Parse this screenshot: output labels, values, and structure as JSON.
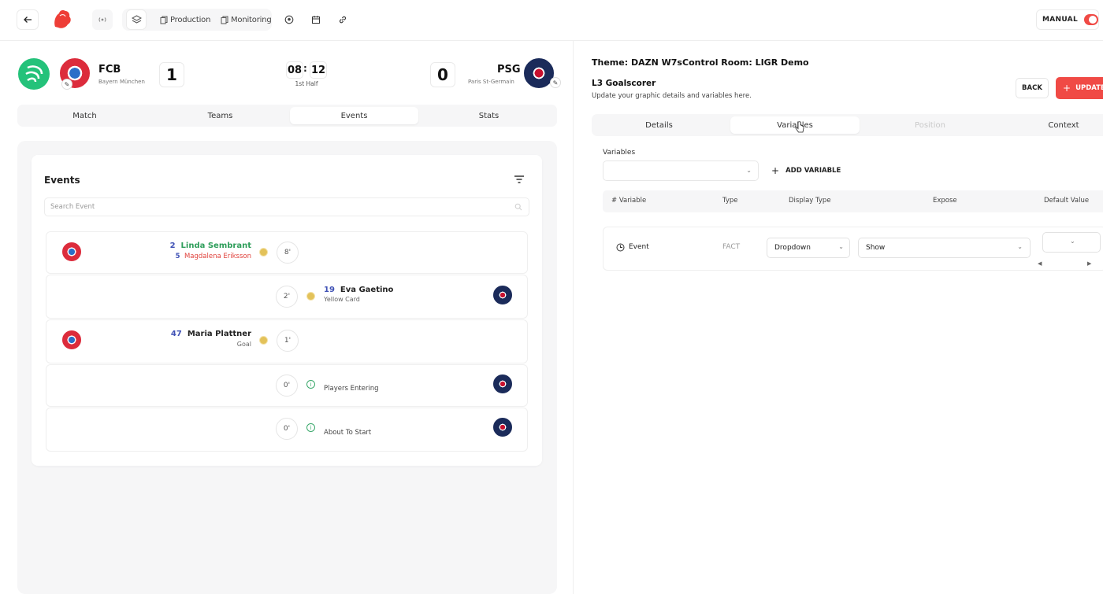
{
  "topbar": {
    "production_label": "Production",
    "monitoring_label": "Monitoring",
    "manual_label": "MANUAL",
    "manual_on": true
  },
  "match": {
    "home": {
      "code": "FCB",
      "name": "Bayern München",
      "score": "1"
    },
    "away": {
      "code": "PSG",
      "name": "Paris St-Germain",
      "score": "0"
    },
    "clock_min": "08",
    "clock_sec": "12",
    "period": "1st Half"
  },
  "left_tabs": [
    {
      "label": "Match"
    },
    {
      "label": "Teams"
    },
    {
      "label": "Events"
    },
    {
      "label": "Stats"
    }
  ],
  "events": {
    "title": "Events",
    "search_placeholder": "Search Event",
    "rows": [
      {
        "side": "home",
        "minute": "8'",
        "line1_num": "2",
        "line1_name": "Linda Sembrant",
        "line2_num": "5",
        "line2_name": "Magdalena Eriksson"
      },
      {
        "side": "away",
        "minute": "2'",
        "num": "19",
        "name": "Eva Gaetino",
        "sub": "Yellow Card"
      },
      {
        "side": "home",
        "minute": "1'",
        "num": "47",
        "name": "Maria Plattner",
        "sub": "Goal"
      },
      {
        "side": "away",
        "minute": "0'",
        "text": "Players Entering"
      },
      {
        "side": "away",
        "minute": "0'",
        "text": "About To Start"
      }
    ]
  },
  "right": {
    "theme": "Theme: DAZN W7s",
    "control_room": "Control Room: LIGR Demo",
    "title": "L3 Goalscorer",
    "subtitle": "Update your graphic details and variables here.",
    "back_label": "BACK",
    "update_label": "UPDATE G",
    "tabs": [
      {
        "label": "Details"
      },
      {
        "label": "Variables"
      },
      {
        "label": "Position"
      },
      {
        "label": "Context"
      }
    ],
    "variables_label": "Variables",
    "add_variable_label": "ADD VARIABLE",
    "table_headers": [
      "# Variable",
      "Type",
      "Display Type",
      "Expose",
      "Default Value"
    ],
    "row": {
      "name": "Event",
      "type": "FACT",
      "display_type": "Dropdown",
      "expose": "Show"
    }
  },
  "colors": {
    "accent": "#f04a45",
    "brand_green": "#24c27a",
    "fcb_red": "#dc2c3c",
    "psg_navy": "#1b2b5a"
  }
}
